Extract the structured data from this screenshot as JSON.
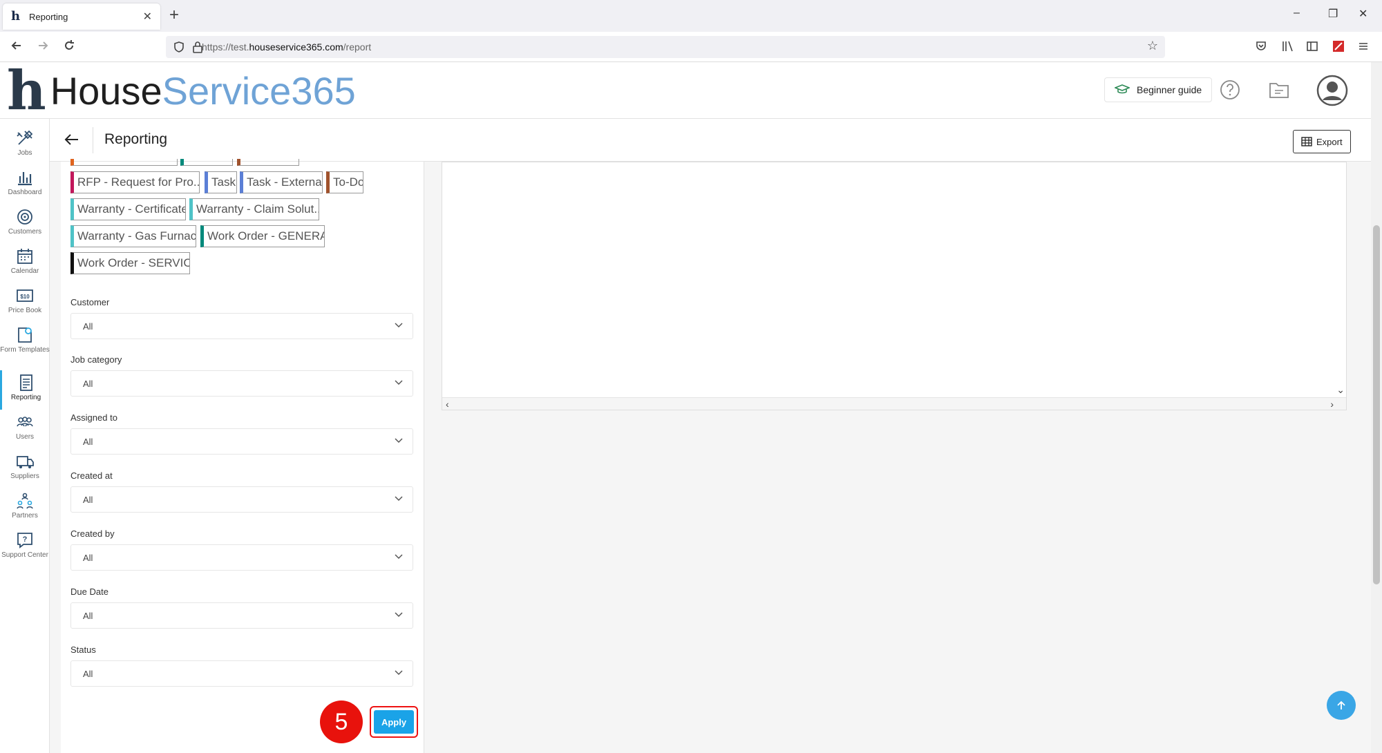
{
  "browser": {
    "tab_title": "Reporting",
    "tab_close": "✕",
    "new_tab": "+",
    "url_prefix": "https://test.",
    "url_domain": "houseservice365.com",
    "url_path": "/report",
    "win_min": "–",
    "win_max": "❐",
    "win_close": "✕"
  },
  "header": {
    "logo_h": "h",
    "logo_dark": "House",
    "logo_blue": "Service365",
    "beginner_guide": "Beginner guide"
  },
  "sidebar": {
    "items": [
      {
        "label": "Jobs"
      },
      {
        "label": "Dashboard"
      },
      {
        "label": "Customers"
      },
      {
        "label": "Calendar"
      },
      {
        "label": "Price Book"
      },
      {
        "label": "Form Templates"
      },
      {
        "label": "Reporting"
      },
      {
        "label": "Users"
      },
      {
        "label": "Suppliers"
      },
      {
        "label": "Partners"
      },
      {
        "label": "Support Center"
      }
    ]
  },
  "page": {
    "title": "Reporting",
    "export_label": "Export"
  },
  "tags": [
    {
      "label": "RFP - Request for Pro...",
      "color": "#c2185b"
    },
    {
      "label": "Task",
      "color": "#5b7fd6"
    },
    {
      "label": "Task - External",
      "color": "#5b7fd6"
    },
    {
      "label": "To-Do",
      "color": "#a0522d"
    },
    {
      "label": "Warranty - Certificate",
      "color": "#4fc3c7"
    },
    {
      "label": "Warranty - Claim Solut...",
      "color": "#4fc3c7"
    },
    {
      "label": "Warranty - Gas Furnace",
      "color": "#4fc3c7"
    },
    {
      "label": "Work Order - GENERAL",
      "color": "#00897b"
    },
    {
      "label": "Work Order - SERVICE",
      "color": "#111111"
    }
  ],
  "filters": [
    {
      "label": "Customer",
      "value": "All"
    },
    {
      "label": "Job category",
      "value": "All"
    },
    {
      "label": "Assigned to",
      "value": "All"
    },
    {
      "label": "Created at",
      "value": "All"
    },
    {
      "label": "Created by",
      "value": "All"
    },
    {
      "label": "Due Date",
      "value": "All"
    },
    {
      "label": "Status",
      "value": "All"
    }
  ],
  "apply_label": "Apply",
  "step_number": "5",
  "colors": {
    "accent": "#1aa3e8",
    "step_badge": "#e8120c",
    "logo_blue": "#6fa3d6"
  }
}
